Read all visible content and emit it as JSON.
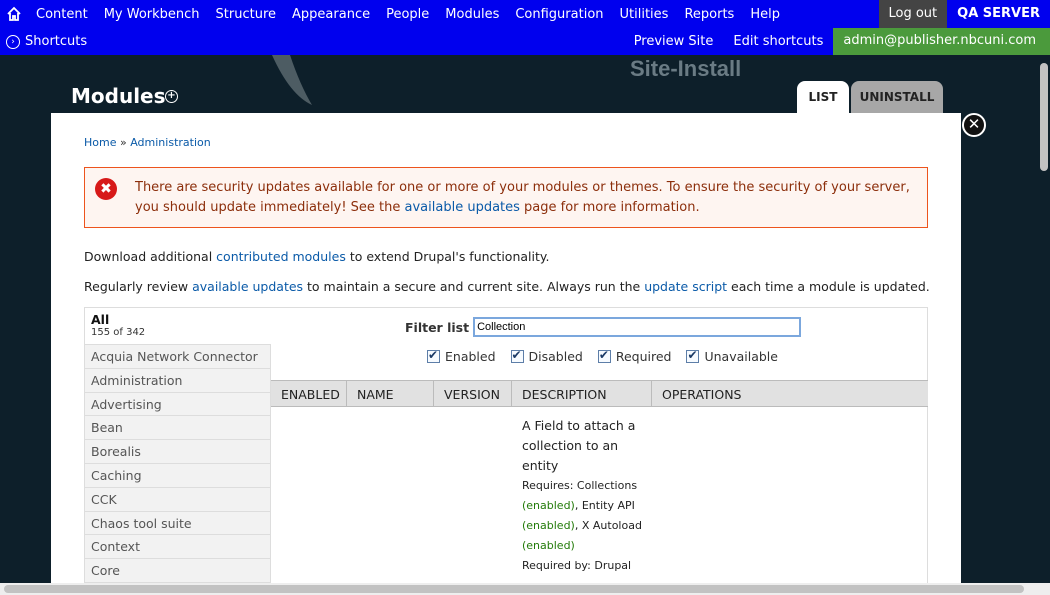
{
  "toolbar": {
    "menu": [
      "Content",
      "My Workbench",
      "Structure",
      "Appearance",
      "People",
      "Modules",
      "Configuration",
      "Utilities",
      "Reports",
      "Help"
    ],
    "logout": "Log out",
    "server": "QA SERVER"
  },
  "shortcuts": {
    "label": "Shortcuts",
    "preview_site": "Preview Site",
    "edit_shortcuts": "Edit shortcuts",
    "user": "admin@publisher.nbcuni.com"
  },
  "header": {
    "site_name": "Site-Install",
    "page_title": "Modules",
    "tabs": [
      "LIST",
      "UNINSTALL"
    ]
  },
  "breadcrumb": {
    "home": "Home",
    "sep": " » ",
    "admin": "Administration"
  },
  "message": {
    "text_before": "There are security updates available for one or more of your modules or themes. To ensure the security of your server, you should update immediately! See the ",
    "link": "available updates",
    "text_after": " page for more information."
  },
  "intro": {
    "p1_before": "Download additional ",
    "p1_link": "contributed modules",
    "p1_after": " to extend Drupal's functionality.",
    "p2_before": "Regularly review ",
    "p2_link1": "available updates",
    "p2_mid": " to maintain a secure and current site. Always run the ",
    "p2_link2": "update script",
    "p2_after": " each time a module is updated."
  },
  "modules": {
    "all_label": "All",
    "count": "155 of 342",
    "categories": [
      "Acquia Network Connector",
      "Administration",
      "Advertising",
      "Bean",
      "Borealis",
      "Caching",
      "CCK",
      "Chaos tool suite",
      "Context",
      "Core"
    ],
    "filter_label": "Filter list",
    "filter_value": "Collection",
    "checkboxes": [
      "Enabled",
      "Disabled",
      "Required",
      "Unavailable"
    ],
    "columns": [
      "ENABLED",
      "NAME",
      "VERSION",
      "DESCRIPTION",
      "OPERATIONS"
    ],
    "row": {
      "description": "A Field to attach a collection to an entity",
      "requires_label": "Requires: Collections",
      "enabled": "(enabled)",
      "req2": ", Entity API",
      "req3": ", X Autoload",
      "required_by": "Required by: Drupal"
    }
  },
  "colors": {
    "toolbar_bg": "#0000ee",
    "user_bg": "#4b9a3c",
    "page_bg": "#0d1f2a",
    "error_border": "#ed541d"
  }
}
